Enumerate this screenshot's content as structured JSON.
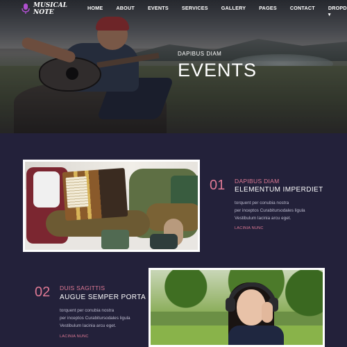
{
  "brand": {
    "logo_line1": "MUSICAL",
    "logo_line2": "NOTE",
    "logo_icon": "microphone-icon",
    "accent": "#e07a95"
  },
  "nav": {
    "items": [
      "HOME",
      "ABOUT",
      "EVENTS",
      "SERVICES",
      "GALLERY",
      "PAGES",
      "CONTACT",
      "DROPDOWN"
    ],
    "dropdown_caret": "▾"
  },
  "hero": {
    "subtitle": "DAPIBUS DIAM",
    "title": "EVENTS"
  },
  "events": [
    {
      "number": "01",
      "subtitle": "DAPIBUS DIAM",
      "title": "ELEMENTUM IMPERDIET",
      "desc_line1": "torquent per conubia nostra",
      "desc_line2": "per inceptos Curabitursodales ligula",
      "desc_line3": "Vestibulum lacinia arcu eget.",
      "link": "LACINIA NUNC"
    },
    {
      "number": "02",
      "subtitle": "DUIS SAGITTIS",
      "title": "AUGUE SEMPER PORTA",
      "desc_line1": "torquent per conubia nostra",
      "desc_line2": "per inceptos Curabitursodales ligula",
      "desc_line3": "Vestibulum lacinia arcu eget.",
      "link": "LACINIA NUNC"
    }
  ]
}
